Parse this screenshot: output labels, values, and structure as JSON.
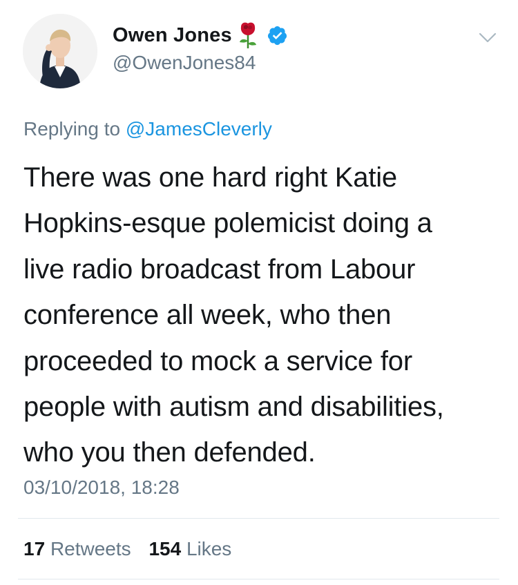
{
  "author": {
    "display_name": "Owen Jones",
    "handle": "@OwenJones84"
  },
  "reply": {
    "prefix": "Replying to",
    "mention": "@JamesCleverly"
  },
  "tweet": {
    "lines": [
      "There was one hard right Katie",
      "Hopkins-esque polemicist doing a",
      "live radio broadcast from Labour",
      "conference all week, who then",
      "proceeded to mock a service for",
      "people with autism and disabilities,",
      "who you then defended."
    ],
    "timestamp": "03/10/2018, 18:28"
  },
  "stats": {
    "retweets_count": "17",
    "retweets_label": "Retweets",
    "likes_count": "154",
    "likes_label": "Likes"
  },
  "icons": {
    "rose": "red-rose-emoji",
    "verified": "verified-badge-icon",
    "menu": "chevron-down-icon"
  },
  "colors": {
    "text": "#14171a",
    "secondary": "#657786",
    "link": "#1b95e0",
    "verified": "#1da1f2",
    "divider": "#e1e8ed"
  }
}
